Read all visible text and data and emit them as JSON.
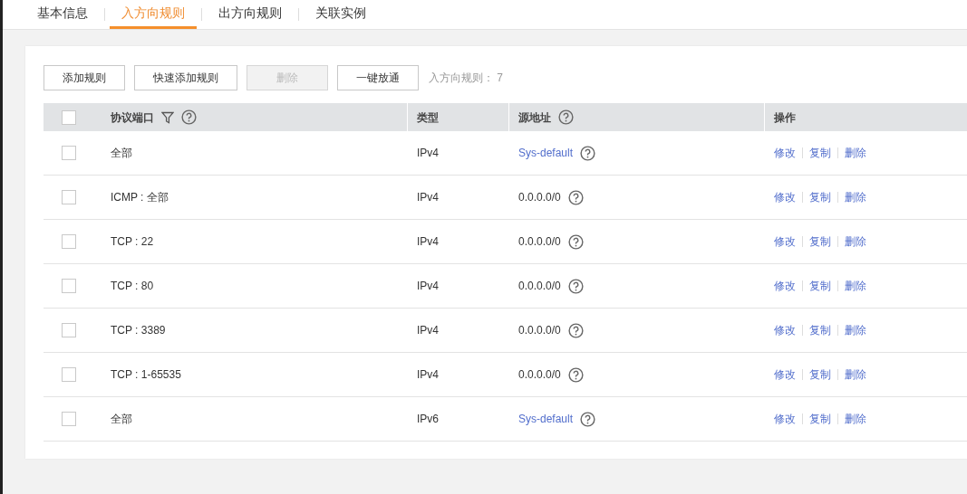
{
  "tabs": [
    {
      "label": "基本信息",
      "selected": false
    },
    {
      "label": "入方向规则",
      "selected": true
    },
    {
      "label": "出方向规则",
      "selected": false
    },
    {
      "label": "关联实例",
      "selected": false
    }
  ],
  "toolbar": {
    "buttons": [
      {
        "label": "添加规则",
        "disabled": false
      },
      {
        "label": "快速添加规则",
        "disabled": false
      },
      {
        "label": "删除",
        "disabled": true
      },
      {
        "label": "一键放通",
        "disabled": false
      }
    ],
    "count_label": "入方向规则：",
    "count": "7"
  },
  "table": {
    "select_all_checked": false,
    "columns": [
      "协议端口",
      "类型",
      "源地址",
      "操作"
    ],
    "rows": [
      {
        "checked": false,
        "protocol": "全部",
        "type": "IPv4",
        "source": {
          "kind": "link",
          "text": "Sys-default"
        },
        "actions": [
          "修改",
          "复制",
          "删除"
        ]
      },
      {
        "checked": false,
        "protocol": "ICMP : 全部",
        "type": "IPv4",
        "source": {
          "kind": "text",
          "text": "0.0.0.0/0"
        },
        "actions": [
          "修改",
          "复制",
          "删除"
        ]
      },
      {
        "checked": false,
        "protocol": "TCP : 22",
        "type": "IPv4",
        "source": {
          "kind": "text",
          "text": "0.0.0.0/0"
        },
        "actions": [
          "修改",
          "复制",
          "删除"
        ]
      },
      {
        "checked": false,
        "protocol": "TCP : 80",
        "type": "IPv4",
        "source": {
          "kind": "text",
          "text": "0.0.0.0/0"
        },
        "actions": [
          "修改",
          "复制",
          "删除"
        ]
      },
      {
        "checked": false,
        "protocol": "TCP : 3389",
        "type": "IPv4",
        "source": {
          "kind": "text",
          "text": "0.0.0.0/0"
        },
        "actions": [
          "修改",
          "复制",
          "删除"
        ]
      },
      {
        "checked": false,
        "protocol": "TCP : 1-65535",
        "type": "IPv4",
        "source": {
          "kind": "text",
          "text": "0.0.0.0/0"
        },
        "actions": [
          "修改",
          "复制",
          "删除"
        ]
      },
      {
        "checked": false,
        "protocol": "全部",
        "type": "IPv6",
        "source": {
          "kind": "link",
          "text": "Sys-default"
        },
        "actions": [
          "修改",
          "复制",
          "删除"
        ]
      }
    ]
  }
}
